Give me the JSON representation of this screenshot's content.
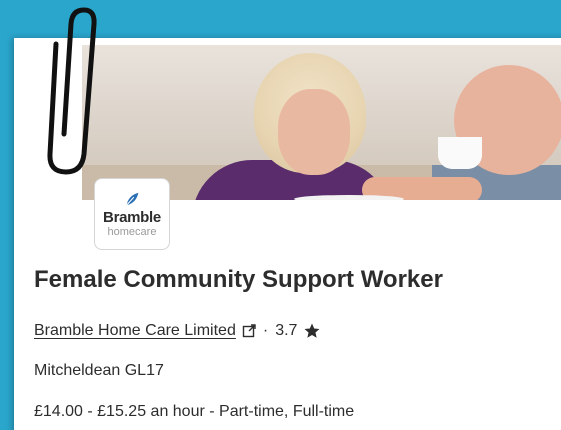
{
  "job": {
    "title": "Female Community Support Worker",
    "company": "Bramble Home Care Limited",
    "separator": "·",
    "rating": "3.7",
    "location": "Mitcheldean GL17",
    "salary": "£14.00 - £15.25 an hour  - Part-time, Full-time"
  },
  "logo": {
    "name": "Bramble",
    "sub": "homecare"
  },
  "icons": {
    "external": "external-link-icon",
    "rating": "star-icon",
    "clip": "paperclip-icon",
    "leaf": "leaf-icon"
  },
  "colors": {
    "background": "#2aa6cc",
    "text": "#2d2d2d",
    "logo_leaf": "#2b6fb6"
  }
}
